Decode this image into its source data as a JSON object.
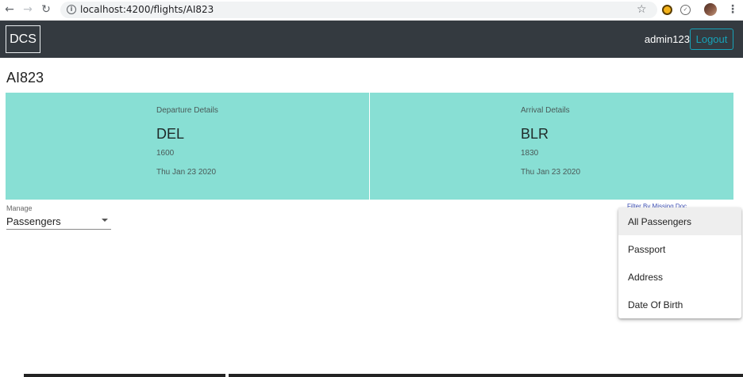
{
  "browser": {
    "url": "localhost:4200/flights/AI823",
    "back_icon": "arrow-left-icon",
    "forward_icon": "arrow-right-icon",
    "reload_icon": "reload-icon"
  },
  "header": {
    "brand": "DCS",
    "username": "admin123",
    "logout_label": "Logout",
    "background": "#343a40",
    "accent": "#17a2b8"
  },
  "flight": {
    "title": "AI823",
    "card_color": "#88dfd4",
    "departure": {
      "label": "Departure Details",
      "code": "DEL",
      "time": "1600",
      "date": "Thu Jan 23 2020"
    },
    "arrival": {
      "label": "Arrival Details",
      "code": "BLR",
      "time": "1830",
      "date": "Thu Jan 23 2020"
    }
  },
  "manage": {
    "label": "Manage",
    "value": "Passengers"
  },
  "filter": {
    "label": "Filter By Missing Doc",
    "options": [
      "All Passengers",
      "Passport",
      "Address",
      "Date Of Birth"
    ],
    "selected_index": 0
  }
}
